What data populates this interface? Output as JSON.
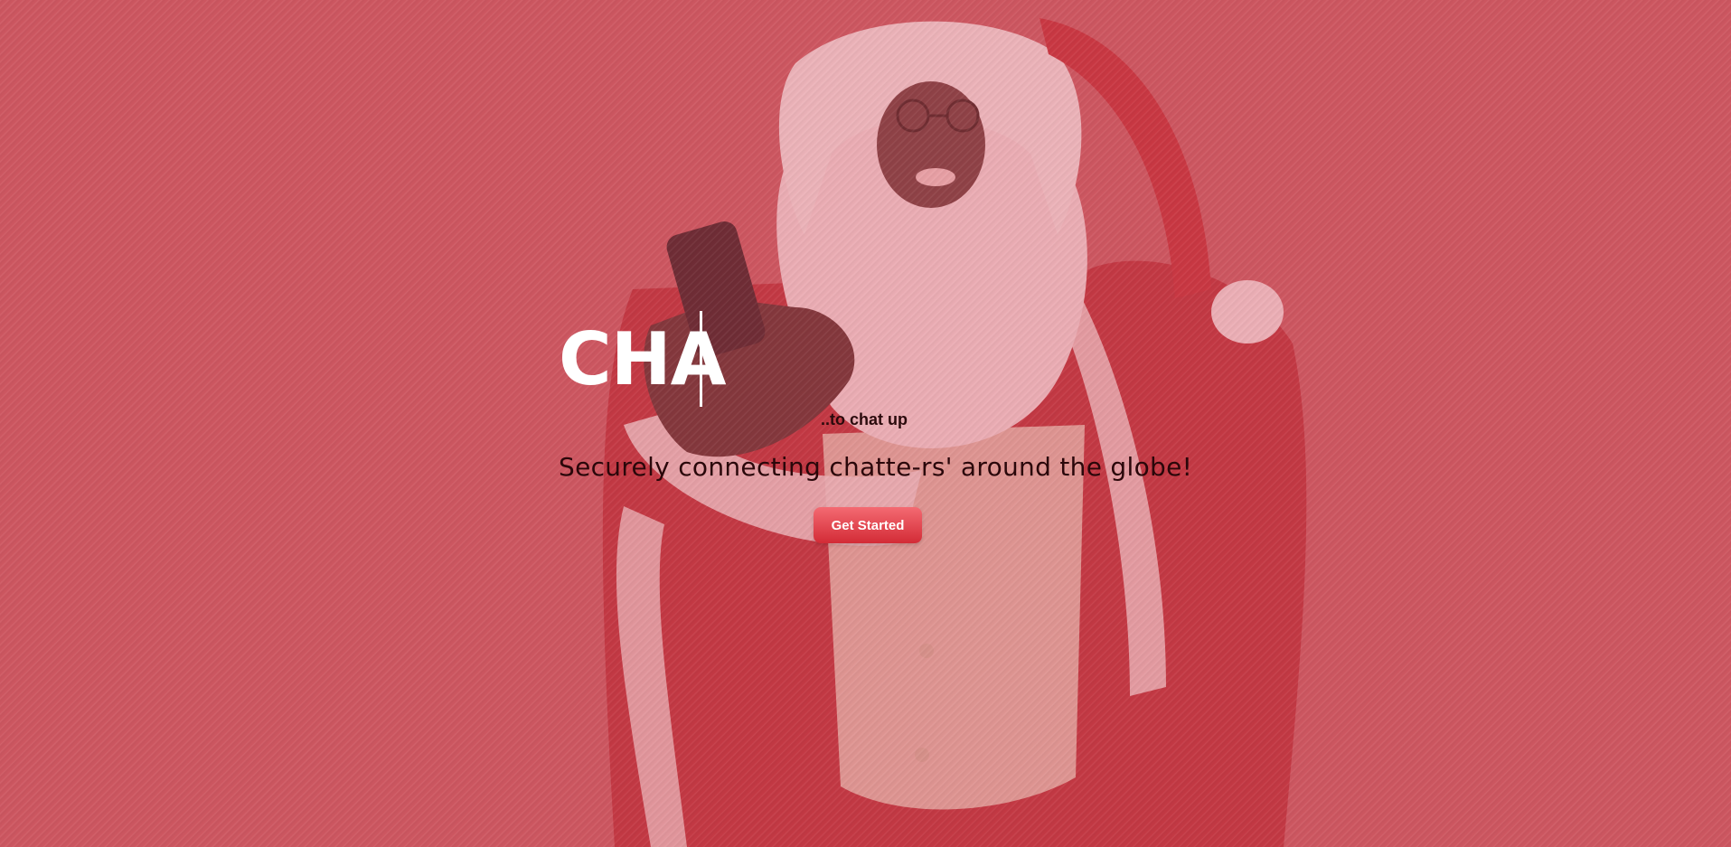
{
  "hero": {
    "title": "CHA",
    "tagline": "..to chat up",
    "subtitle": "Securely connecting chatte-rs' around the globe!",
    "cta_label": "Get Started"
  },
  "colors": {
    "background": "#c95a62",
    "title": "#ffffff",
    "subtitle": "#2a070a",
    "button_top": "#f46a72",
    "button_bottom": "#d32b36"
  },
  "background_image": "santa-with-phone"
}
